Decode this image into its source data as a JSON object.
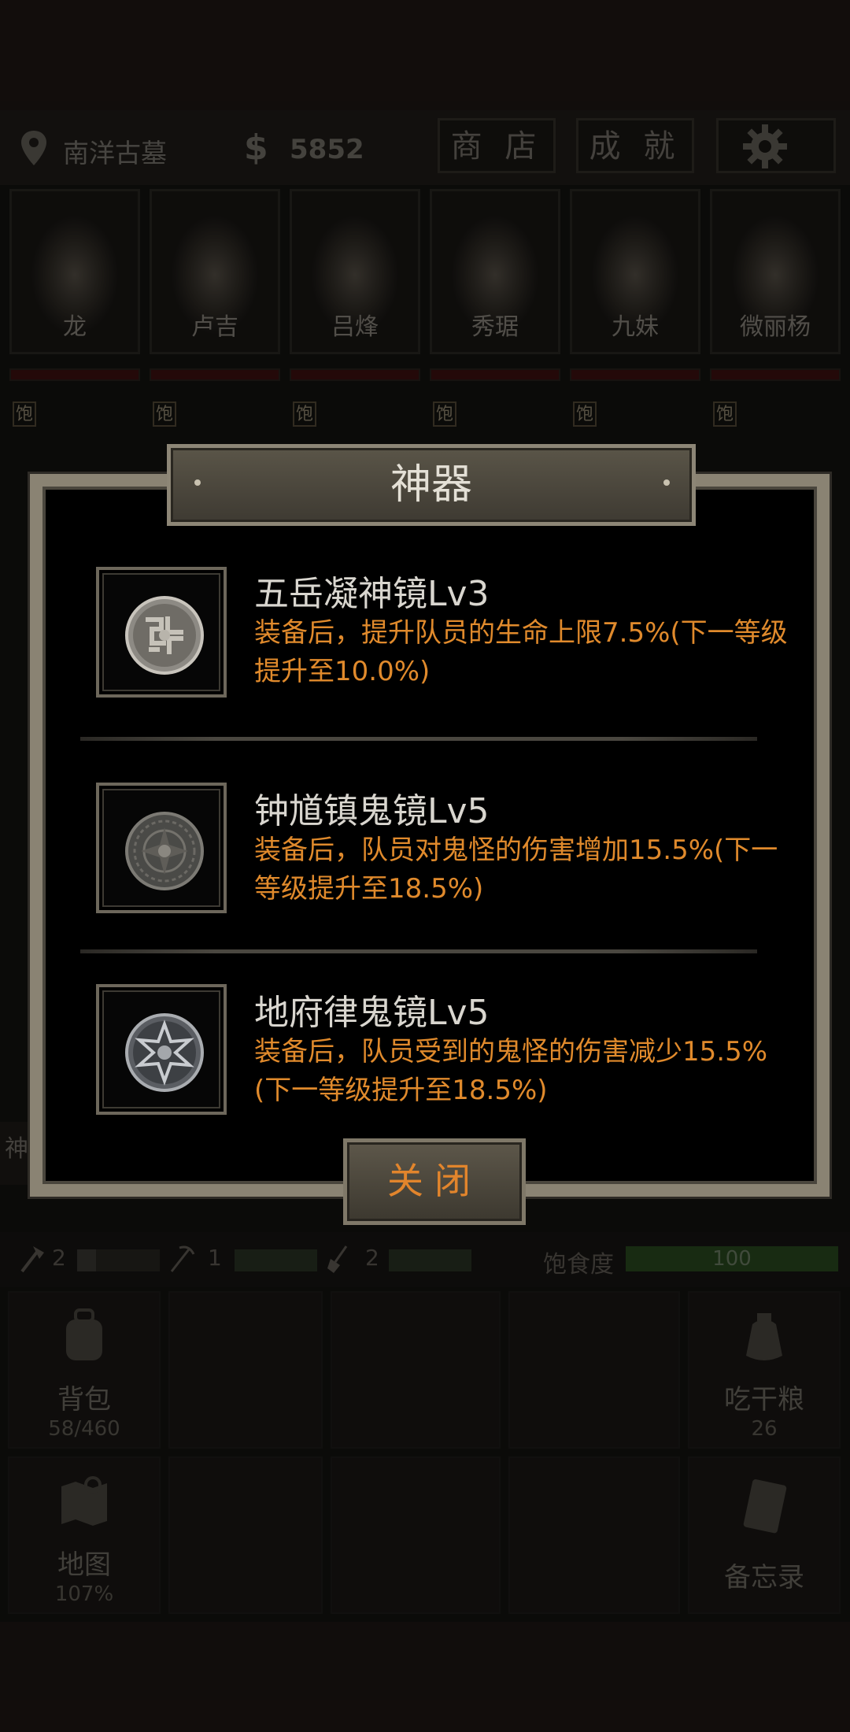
{
  "topbar": {
    "location": "南洋古墓",
    "currency_symbol": "$",
    "money": "5852",
    "shop_label": "商 店",
    "achievements_label": "成 就"
  },
  "members": [
    {
      "name": "龙",
      "status": "饱",
      "hp": 0.95
    },
    {
      "name": "卢吉",
      "status": "饱",
      "hp": 0.95
    },
    {
      "name": "吕烽",
      "status": "饱",
      "hp": 0.95
    },
    {
      "name": "秀琚",
      "status": "饱",
      "hp": 0.95
    },
    {
      "name": "九妹",
      "status": "饱",
      "hp": 0.95
    },
    {
      "name": "微丽杨",
      "status": "饱",
      "hp": 0.95
    }
  ],
  "side_tab": "神",
  "tools": [
    {
      "icon": "axe-icon",
      "count": "2"
    },
    {
      "icon": "pickaxe-icon",
      "count": "1"
    },
    {
      "icon": "shovel-icon",
      "count": "2"
    }
  ],
  "satiety": {
    "label": "饱食度",
    "value": "100"
  },
  "grid": {
    "backpack": {
      "label": "背包",
      "sub": "58/460"
    },
    "ration": {
      "label": "吃干粮",
      "sub": "26"
    },
    "map": {
      "label": "地图",
      "sub": "107%"
    },
    "memo": {
      "label": "备忘录"
    }
  },
  "dialog": {
    "title": "神器",
    "close_label": "关闭",
    "artifacts": [
      {
        "name": "五岳凝神镜Lv3",
        "desc": "装备后，提升队员的生命上限7.5%(下一等级提升至10.0%)"
      },
      {
        "name": "钟馗镇鬼镜Lv5",
        "desc": "装备后，队员对鬼怪的伤害增加15.5%(下一等级提升至18.5%)"
      },
      {
        "name": "地府律鬼镜Lv5",
        "desc": "装备后，队员受到的鬼怪的伤害减少15.5%(下一等级提升至18.5%)"
      }
    ]
  },
  "colors": {
    "accent_orange": "#e08a2c",
    "satiety_green": "#3c6a2e",
    "hp_red": "#5a1616"
  }
}
